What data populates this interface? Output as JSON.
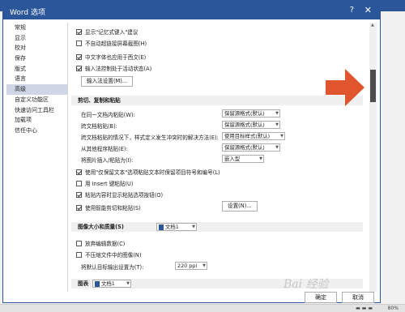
{
  "dialog": {
    "title": "Word 选项",
    "help_glyph": "?",
    "close_glyph": "✕",
    "ok_label": "确定",
    "cancel_label": "取消"
  },
  "sidebar": {
    "items": [
      {
        "label": "常规"
      },
      {
        "label": "显示"
      },
      {
        "label": "校对"
      },
      {
        "label": "保存"
      },
      {
        "label": "版式"
      },
      {
        "label": "语言"
      },
      {
        "label": "高级",
        "active": true
      },
      {
        "label": "自定义功能区"
      },
      {
        "label": "快速访问工具栏"
      },
      {
        "label": "加载项"
      },
      {
        "label": "信任中心"
      }
    ]
  },
  "editing": {
    "opt1": "显示\"记忆式键入\"建议",
    "opt2": "不自动超链接屏幕截图(H)",
    "opt3": "中文字体也应用于西文(E)",
    "opt4": "输入法控制处于活动状态(A)",
    "ime_button": "输入法设置(M)..."
  },
  "paste": {
    "section_title": "剪切、复制和粘贴",
    "rows": [
      {
        "label": "在同一文档内粘贴(W):",
        "value": "保留源格式(默认)"
      },
      {
        "label": "跨文档粘贴(B):",
        "value": "保留源格式(默认)"
      },
      {
        "label": "跨文档粘贴的情况下，样式定义发生冲突时的解决方法(E):",
        "value": "使用目标样式(默认)"
      },
      {
        "label": "从其他程序粘贴(E):",
        "value": "保留源格式(默认)"
      },
      {
        "label": "将图片插入/粘贴为(I):",
        "value": "嵌入型"
      }
    ],
    "opt_keep_bullets": "使用\"仅保留文本\"选项粘贴文本时保留项目符号和编号(L)",
    "opt_insert_key": "用 Insert 键粘贴(U)",
    "opt_show_paste": "粘贴内容时显示粘贴选项按钮(O)",
    "opt_smart": "使用智能剪切和粘贴(S)",
    "settings_button": "设置(N)..."
  },
  "image": {
    "section_title": "图像大小和质量(S)",
    "doc_name": "文档1",
    "opt_discard": "放弃编辑数据(C)",
    "opt_no_compress": "不压缩文件中的图像(N)",
    "target_label": "将默认目标输出设置为(T):",
    "target_value": "220 ppi"
  },
  "chart": {
    "section_title": "图表",
    "doc_name": "文档1"
  },
  "status": {
    "zoom": "80%",
    "controls": "▬ ▬ ▬"
  },
  "watermark": "Bai 经验"
}
